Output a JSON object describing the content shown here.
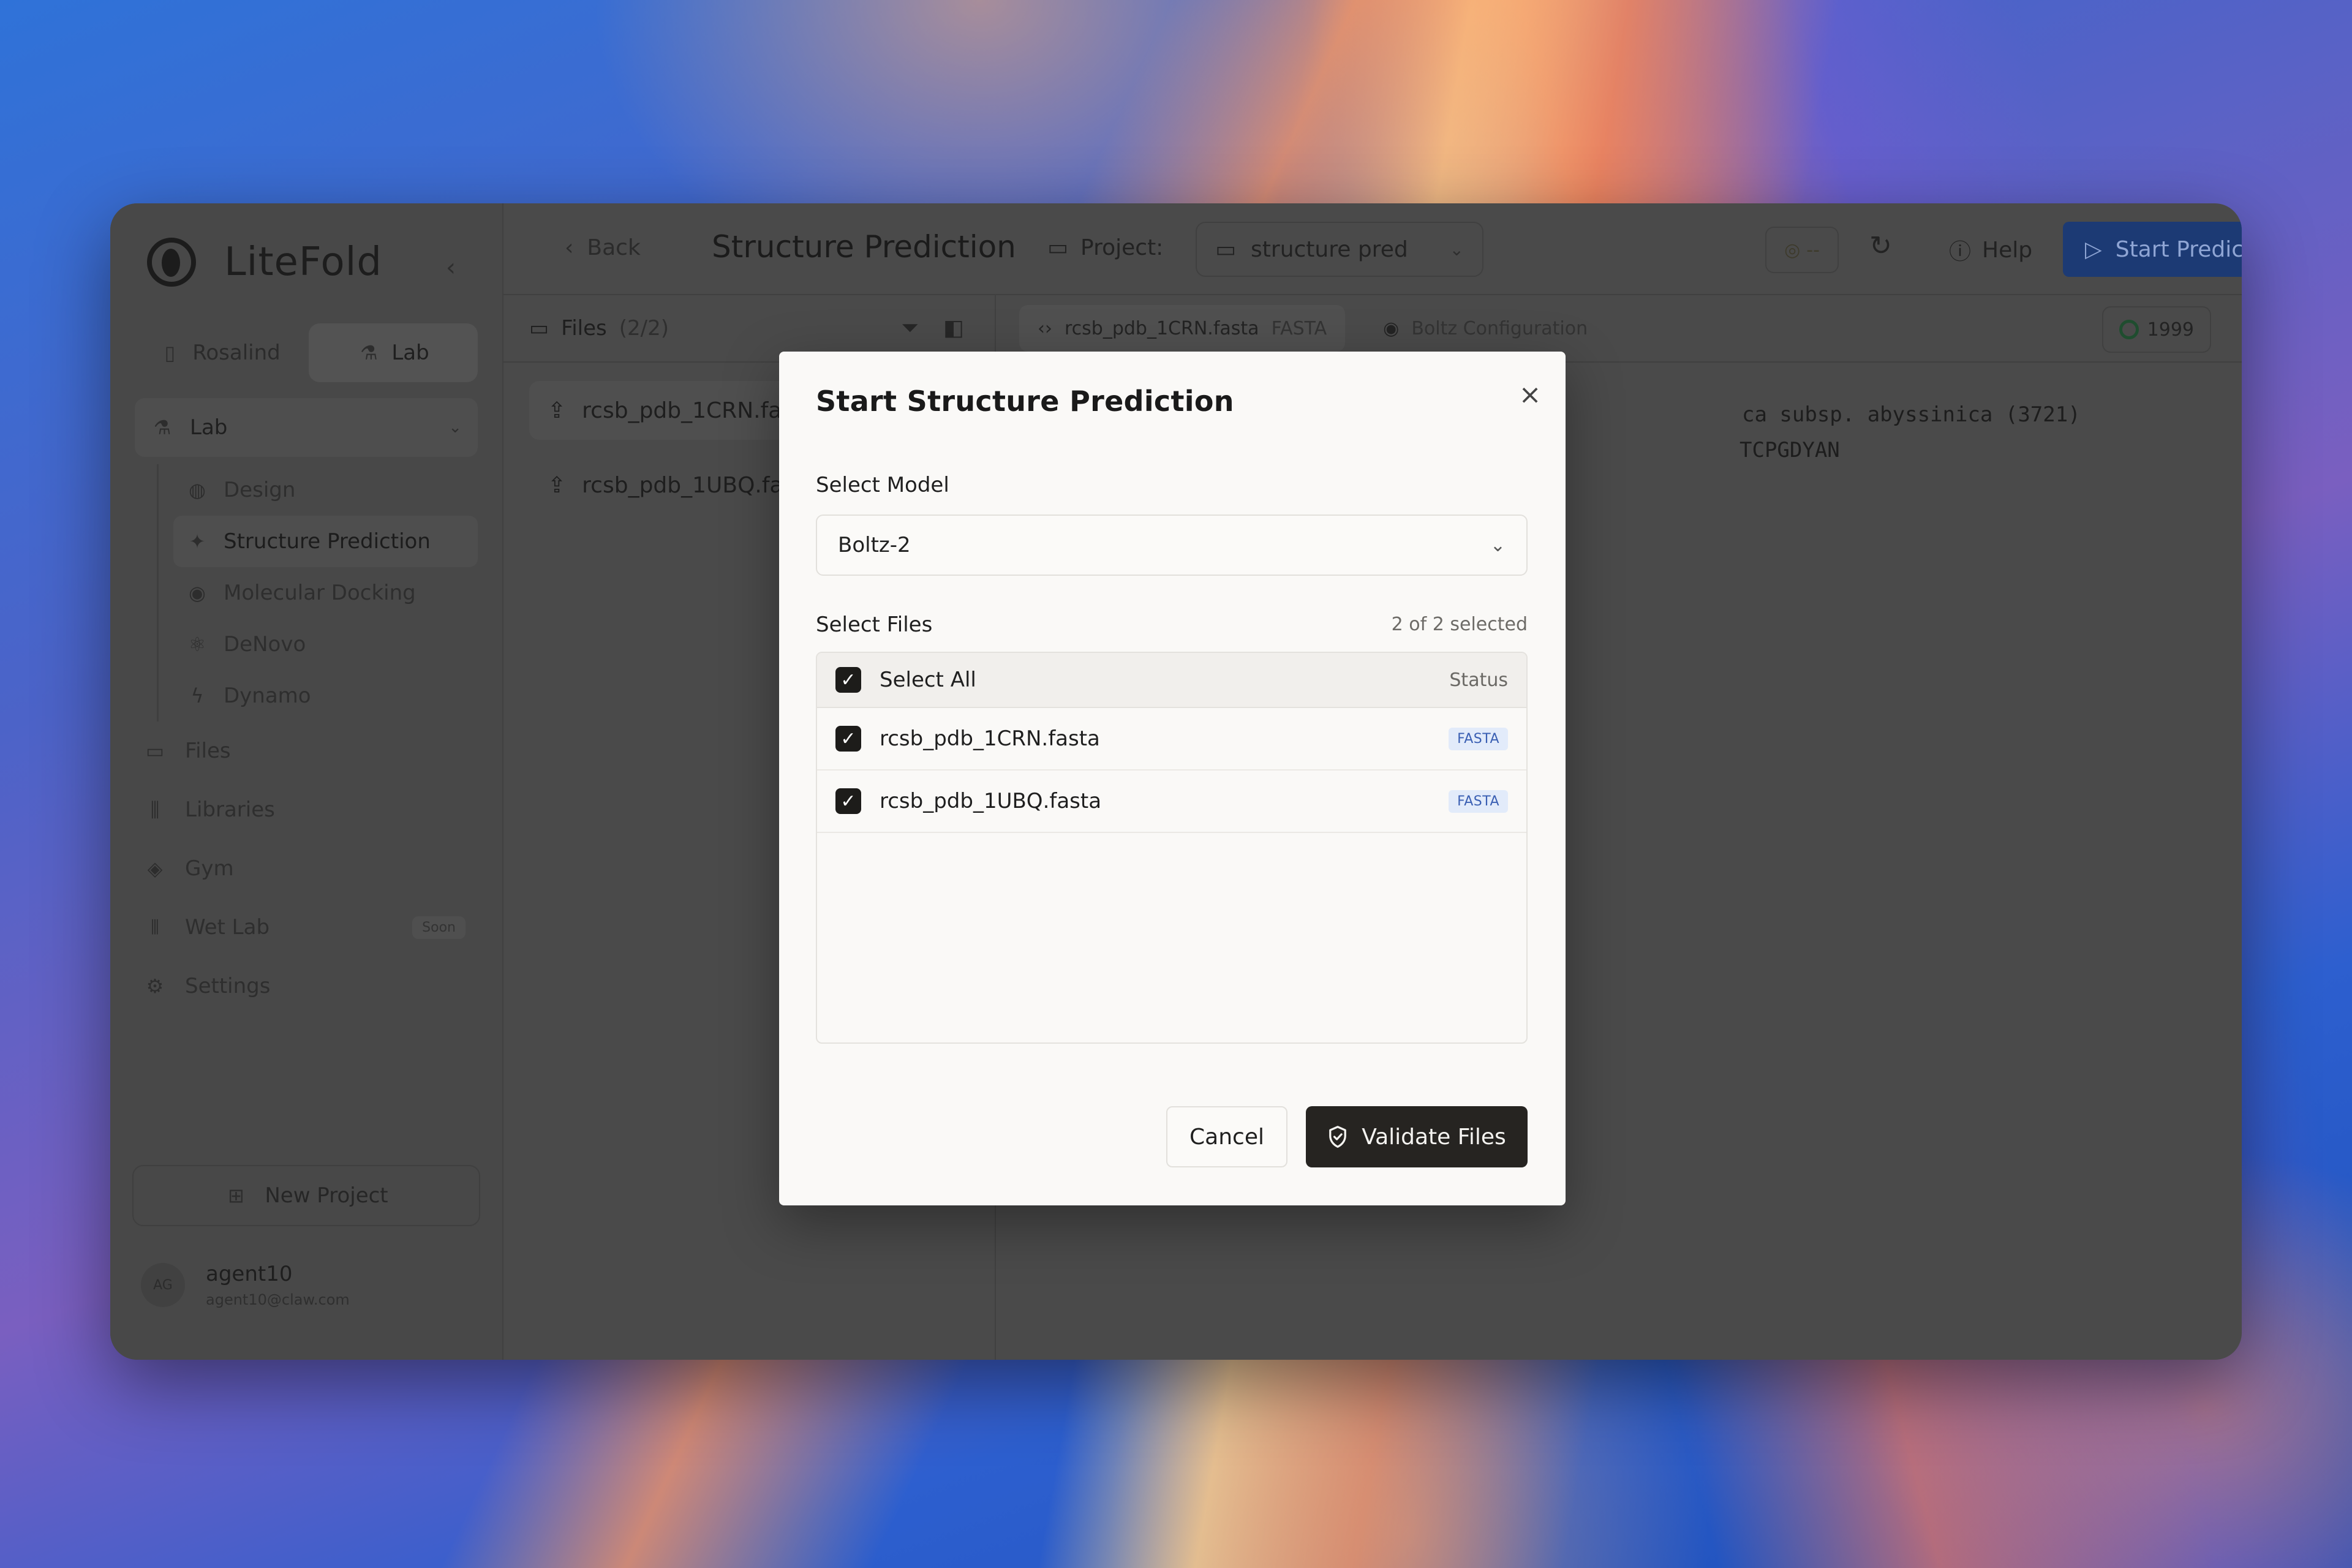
{
  "app": {
    "name": "LiteFold"
  },
  "sidebar": {
    "segments": [
      {
        "label": "Rosalind",
        "icon": "book-icon"
      },
      {
        "label": "Lab",
        "icon": "flask-icon"
      }
    ],
    "lab_group": {
      "label": "Lab",
      "icon": "flask-icon"
    },
    "lab_items": [
      {
        "label": "Design",
        "icon": "palette-icon"
      },
      {
        "label": "Structure Prediction",
        "icon": "sparkle-icon"
      },
      {
        "label": "Molecular Docking",
        "icon": "globe-icon"
      },
      {
        "label": "DeNovo",
        "icon": "atom-icon"
      },
      {
        "label": "Dynamo",
        "icon": "zap-icon"
      }
    ],
    "items": [
      {
        "label": "Files",
        "icon": "folder-icon"
      },
      {
        "label": "Libraries",
        "icon": "library-icon"
      },
      {
        "label": "Gym",
        "icon": "shapes-icon"
      },
      {
        "label": "Wet Lab",
        "icon": "test-tubes-icon",
        "badge": "Soon"
      },
      {
        "label": "Settings",
        "icon": "gear-icon"
      }
    ],
    "new_project": "New Project",
    "user": {
      "initials": "AG",
      "name": "agent10",
      "email": "agent10@claw.com"
    }
  },
  "topbar": {
    "back": "Back",
    "title": "Structure Prediction",
    "project_label": "Project:",
    "project_value": "structure pred",
    "credits": "--",
    "help": "Help",
    "start": "Start Prediction"
  },
  "files_panel": {
    "title": "Files",
    "count": "(2/2)",
    "files": [
      "rcsb_pdb_1CRN.fasta",
      "rcsb_pdb_1UBQ.fasta"
    ]
  },
  "editor": {
    "tab_file": "rcsb_pdb_1CRN.fasta",
    "tab_format": "FASTA",
    "tab_config": "Boltz Configuration",
    "residue_count": "1999",
    "line1": "ca subsp. abyssinica (3721)",
    "line2": "TCPGDYAN"
  },
  "modal": {
    "title": "Start Structure Prediction",
    "model_label": "Select Model",
    "model_value": "Boltz-2",
    "files_label": "Select Files",
    "selected_count": "2 of 2 selected",
    "select_all": "Select All",
    "status_header": "Status",
    "files": [
      {
        "name": "rcsb_pdb_1CRN.fasta",
        "badge": "FASTA"
      },
      {
        "name": "rcsb_pdb_1UBQ.fasta",
        "badge": "FASTA"
      }
    ],
    "cancel": "Cancel",
    "validate": "Validate Files"
  },
  "colors": {
    "primary_dark": "#262421",
    "badge_blue": "#3a5fb3",
    "start_button": "#1c3a74"
  }
}
